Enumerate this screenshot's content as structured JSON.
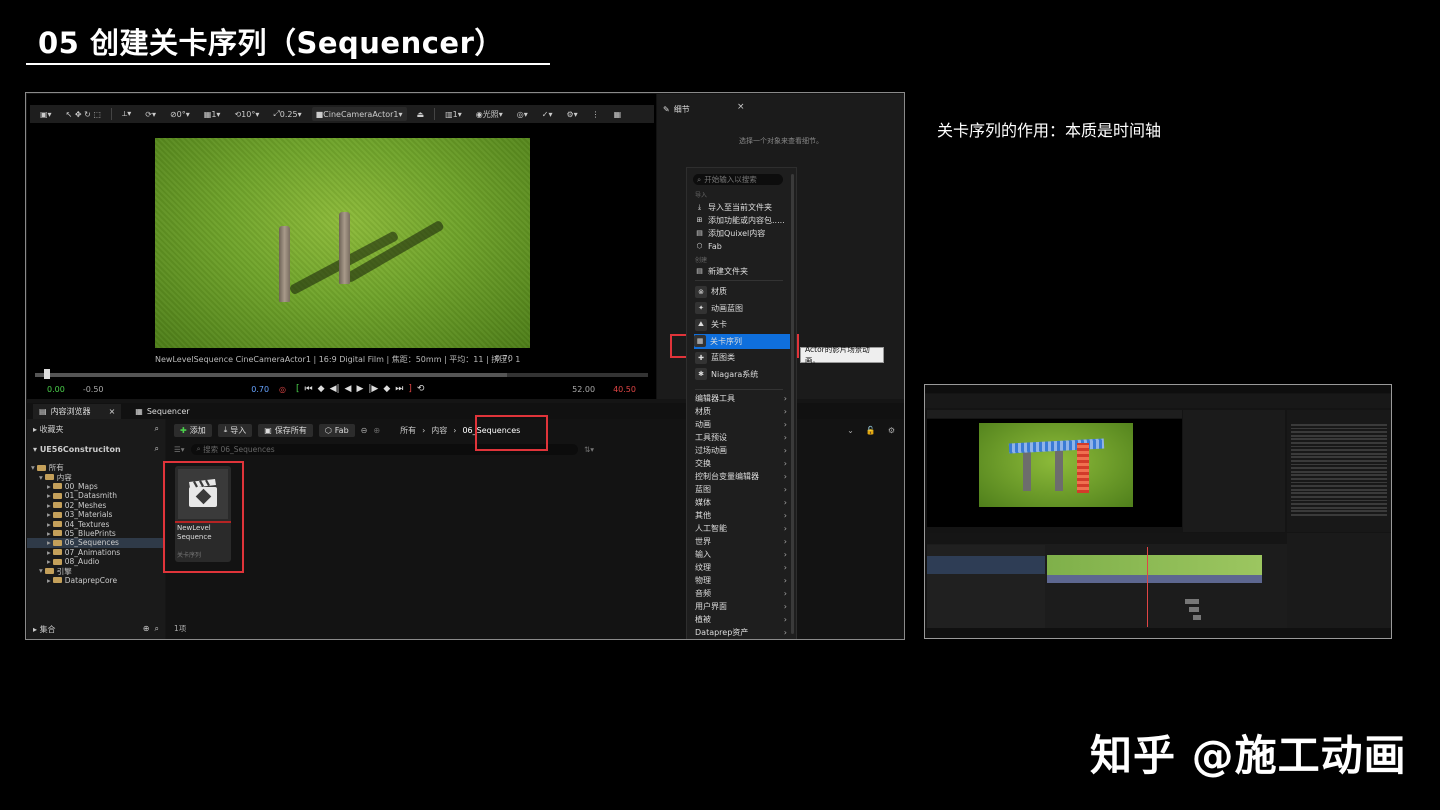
{
  "slide": {
    "title": "05 创建关卡序列（Sequencer）",
    "note": "关卡序列的作用：本质是时间轴",
    "watermark": "知乎 @施工动画"
  },
  "viewport": {
    "toolbar": {
      "snap_angle": "0°",
      "grid": "1",
      "rotation": "10°",
      "scale": "0.25",
      "camera": "CineCameraActor1",
      "count": "1",
      "lit": "光照"
    },
    "caption": "NewLevelSequence CineCameraActor1 | 16:9 Digital Film | 焦距：50mm | 平均：11 | 挤压：1",
    "frame_value": "0.70",
    "controls": {
      "start": "0.00",
      "start_neg": "-0.50",
      "current": "0.70",
      "end": "52.00",
      "end_red": "40.50"
    }
  },
  "details_panel": {
    "tab_label": "细节",
    "hint": "选择一个对象来查看细节。"
  },
  "context_menu": {
    "search_placeholder": "开始输入以搜索",
    "section_import": "导入",
    "import_items": [
      "导入至当前文件夹",
      "添加功能或内容包.....",
      "添加Quixel内容",
      "Fab"
    ],
    "section_folder": "创建",
    "new_folder": "新建文件夹",
    "basic_items": [
      "材质",
      "动画蓝图",
      "关卡",
      "关卡序列",
      "蓝图类",
      "Niagara系统"
    ],
    "submenus": [
      "编辑器工具",
      "材质",
      "动画",
      "工具预设",
      "过场动画",
      "交换",
      "控制台变量编辑器",
      "蓝图",
      "媒体",
      "其他",
      "人工智能",
      "世界",
      "输入",
      "纹理",
      "物理",
      "音频",
      "用户界面",
      "植被",
      "Dataprep资产"
    ],
    "tooltip": "Actor的影片场景动画。"
  },
  "content_browser": {
    "tabs": [
      "内容浏览器",
      "Sequencer"
    ],
    "favorites": "收藏夹",
    "project": "UE56Construciton",
    "tree": [
      {
        "label": "所有",
        "depth": 0
      },
      {
        "label": "内容",
        "depth": 1
      },
      {
        "label": "00_Maps",
        "depth": 2
      },
      {
        "label": "01_Datasmith",
        "depth": 2
      },
      {
        "label": "02_Meshes",
        "depth": 2
      },
      {
        "label": "03_Materials",
        "depth": 2
      },
      {
        "label": "04_Textures",
        "depth": 2
      },
      {
        "label": "05_BluePrints",
        "depth": 2
      },
      {
        "label": "06_Sequences",
        "depth": 2,
        "selected": true
      },
      {
        "label": "07_Animations",
        "depth": 2
      },
      {
        "label": "08_Audio",
        "depth": 2
      },
      {
        "label": "引擎",
        "depth": 1
      },
      {
        "label": "DataprepCore",
        "depth": 2
      }
    ],
    "collections": "集合",
    "toolbar": {
      "add": "添加",
      "import": "导入",
      "save_all": "保存所有",
      "fab": "Fab"
    },
    "breadcrumb": [
      "所有",
      "内容",
      "06_Sequences"
    ],
    "search_placeholder": "搜索 06_Sequences",
    "asset": {
      "name": "NewLevel Sequence",
      "type": "关卡序列"
    },
    "item_count": "1项"
  },
  "colors": {
    "highlight": "#e0343a",
    "menu_active": "#0f6fdc",
    "grass": "#6fa32a"
  }
}
